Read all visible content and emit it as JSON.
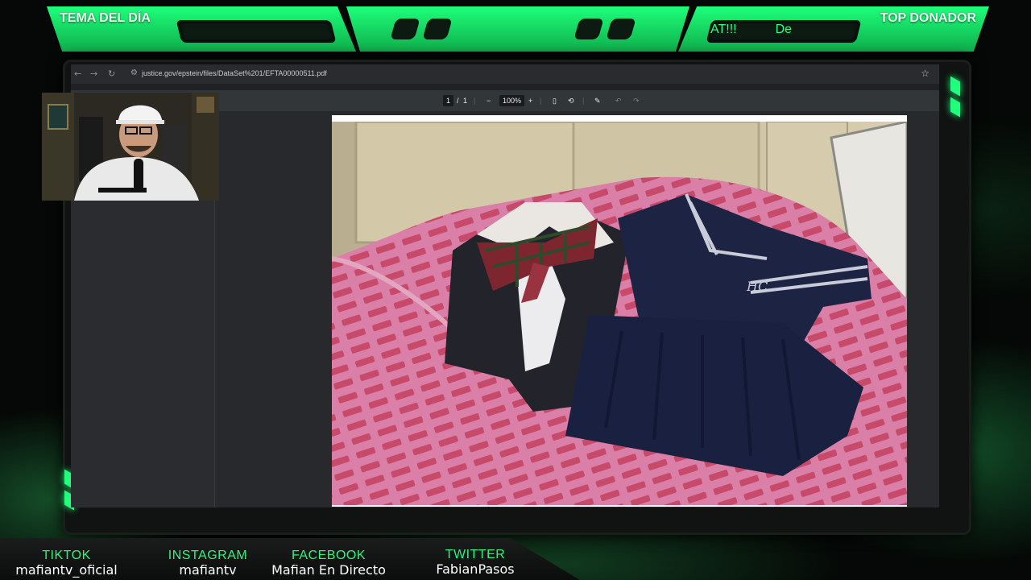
{
  "overlay": {
    "left_title": "TEMA DEL DÍA",
    "right_title": "TOP DONADOR",
    "ticker_segments": [
      "AT!!!",
      "De"
    ],
    "accent": "#22ff7c"
  },
  "browser": {
    "url": "justice.gov/epstein/files/DataSet%201/EFTA00000511.pdf",
    "nav_icons": [
      "back-icon",
      "forward-icon",
      "reload-icon"
    ],
    "pdf_toolbar": {
      "page_current": "1",
      "page_separator": "/",
      "page_total": "1",
      "zoom_out": "−",
      "zoom": "100%",
      "zoom_in": "+",
      "undo": "↶",
      "redo": "↷"
    }
  },
  "socials": [
    {
      "name": "TIKTOK",
      "handle": "mafiantv_oficial"
    },
    {
      "name": "INSTAGRAM",
      "handle": "mafiantv"
    },
    {
      "name": "FACEBOOK",
      "handle": "Mafian En Directo"
    },
    {
      "name": "TWITTER",
      "handle": "FabianPasos"
    }
  ]
}
